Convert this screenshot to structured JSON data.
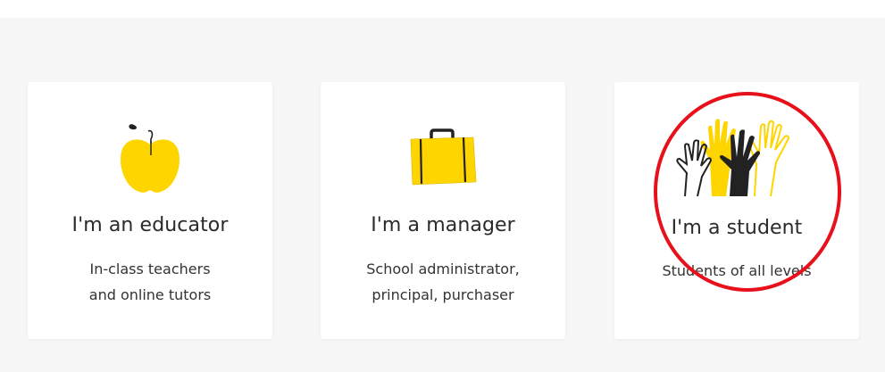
{
  "cards": [
    {
      "icon": "apple-icon",
      "title": "I'm an educator",
      "desc_lines": [
        "In-class teachers",
        "and online tutors"
      ]
    },
    {
      "icon": "briefcase-icon",
      "title": "I'm a manager",
      "desc_lines": [
        "School administrator,",
        "principal, purchaser"
      ]
    },
    {
      "icon": "raised-hands-icon",
      "title": "I'm a student",
      "desc_lines": [
        "Students of all levels"
      ]
    }
  ],
  "colors": {
    "accent_yellow": "#ffd500",
    "highlight_red": "#e8101a",
    "section_background": "#f7f7f7"
  }
}
